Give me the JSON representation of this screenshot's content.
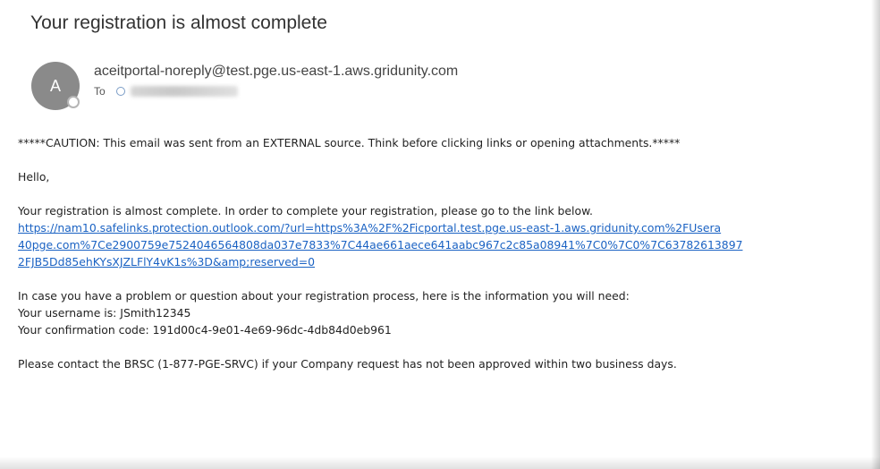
{
  "email": {
    "subject": "Your registration is almost complete",
    "avatar_initial": "A",
    "sender": "aceitportal-noreply@test.pge.us-east-1.aws.gridunity.com",
    "to_label": "To"
  },
  "body": {
    "caution": "*****CAUTION: This email was sent from an EXTERNAL source. Think before clicking links or opening attachments.*****",
    "greeting": "Hello,",
    "intro": "Your registration is almost complete.  In order to complete your registration, please go to the link below.",
    "link_line1": "https://nam10.safelinks.protection.outlook.com/?url=https%3A%2F%2Ficportal.test.pge.us-east-1.aws.gridunity.com%2FUsera",
    "link_line2": "40pge.com%7Ce2900759e7524046564808da037e7833%7C44ae661aece641aabc967c2c85a08941%7C0%7C0%7C63782613897",
    "link_line3": "2FJB5Dd85ehKYsXJZLFlY4vK1s%3D&amp;reserved=0",
    "problem": "In case you have a problem or question about your registration process, here is the information you will need:",
    "username": "Your username is: JSmith12345",
    "confirmation": "Your confirmation code: 191d00c4-9e01-4e69-96dc-4db84d0eb961",
    "contact": "Please contact the BRSC (1-877-PGE-SRVC) if your Company request has not been approved within two business days."
  },
  "colors": {
    "link": "#1a62c3",
    "avatar": "#8a8a8a"
  }
}
